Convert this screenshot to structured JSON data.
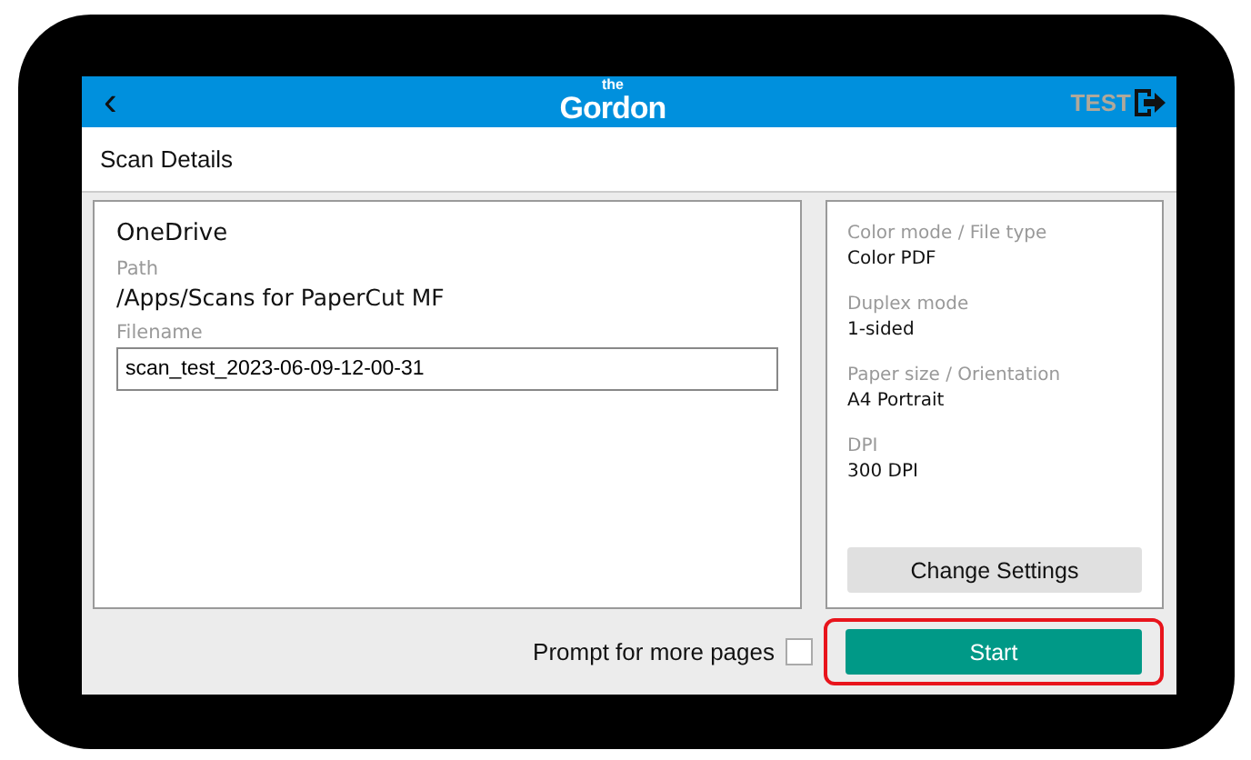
{
  "header": {
    "back": "‹",
    "logo_small": "the",
    "logo": "Gordon",
    "user": "TEST"
  },
  "title": "Scan Details",
  "destination": {
    "name": "OneDrive",
    "path_label": "Path",
    "path": "/Apps/Scans for PaperCut MF",
    "filename_label": "Filename",
    "filename": "scan_test_2023-06-09-12-00-31"
  },
  "settings": [
    {
      "label": "Color mode / File type",
      "value": "Color PDF"
    },
    {
      "label": "Duplex mode",
      "value": "1-sided"
    },
    {
      "label": "Paper size / Orientation",
      "value": "A4 Portrait"
    },
    {
      "label": "DPI",
      "value": "300 DPI"
    }
  ],
  "change_button": "Change Settings",
  "prompt": {
    "label": "Prompt for more pages",
    "checked": false
  },
  "start_button": {
    "label": "Start",
    "highlighted": true
  }
}
